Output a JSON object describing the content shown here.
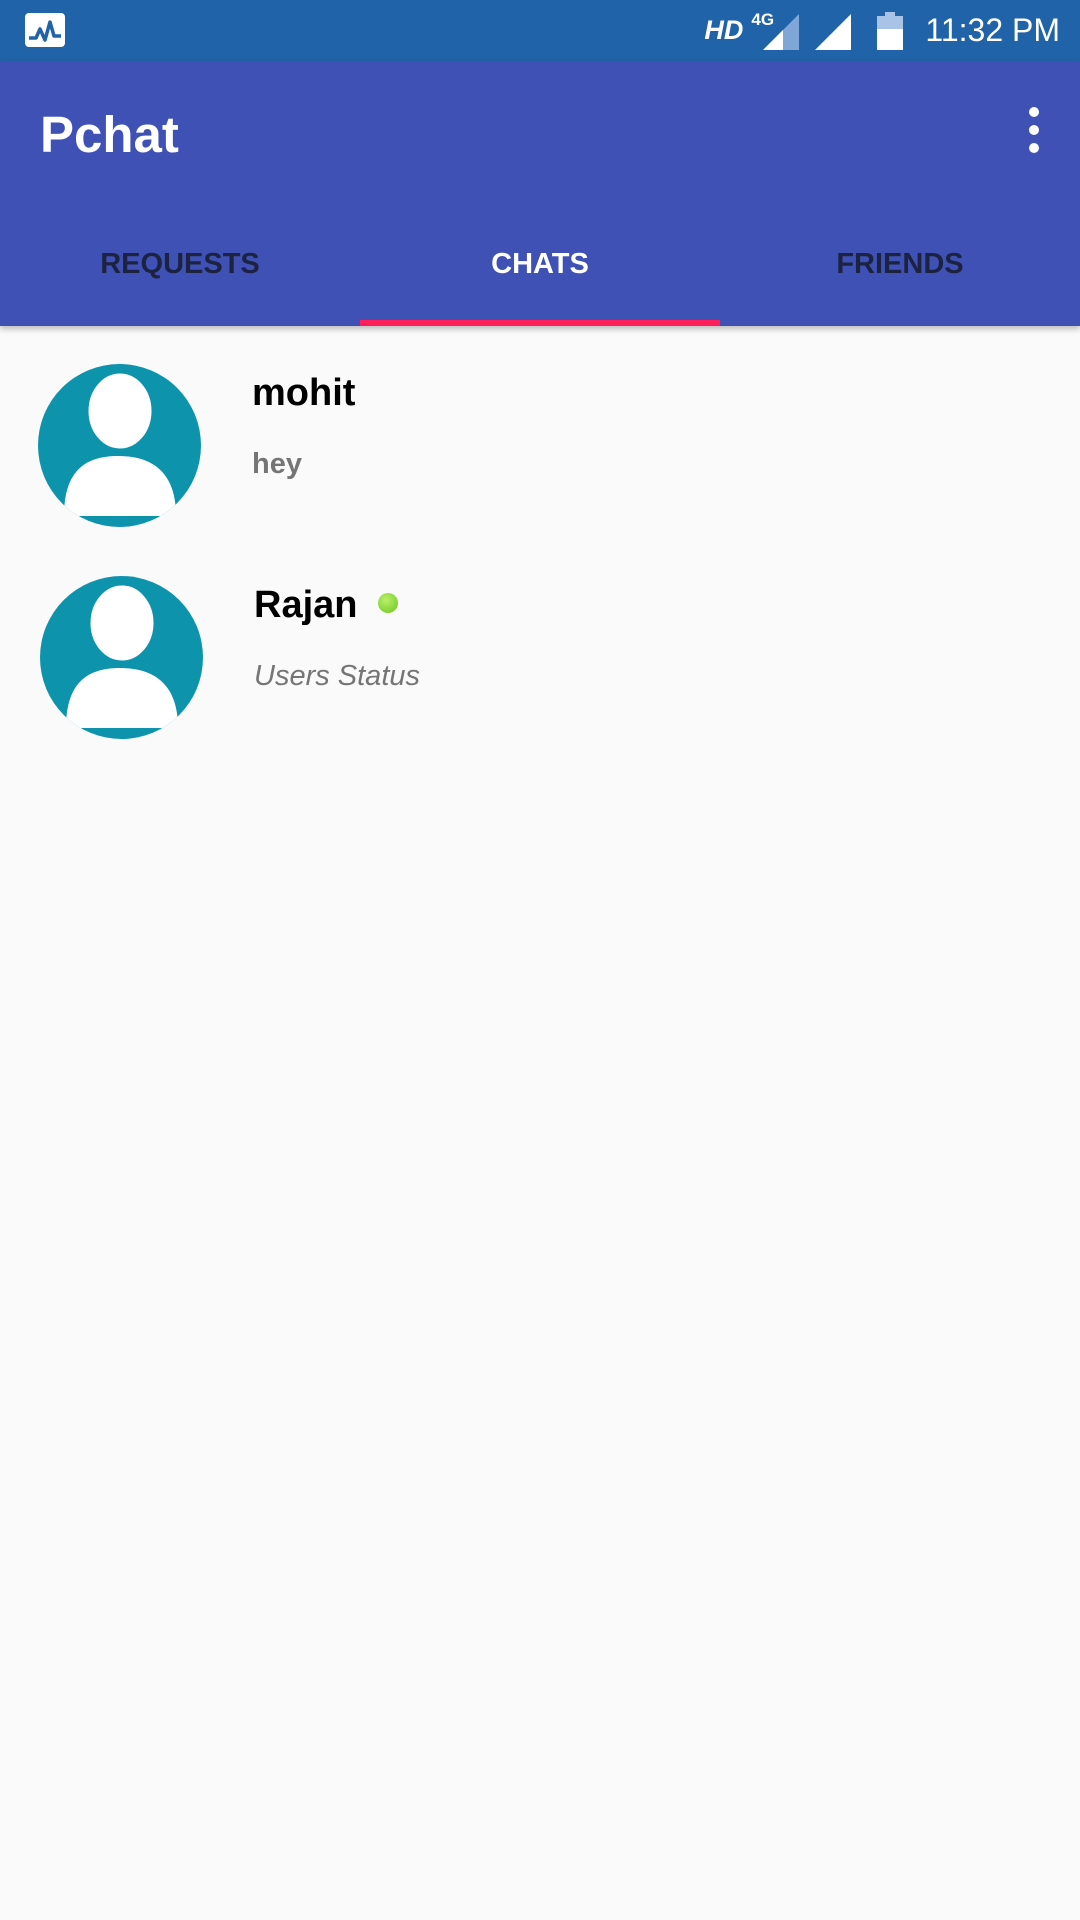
{
  "status_bar": {
    "network_label": "HD",
    "network_type": "4G",
    "time": "11:32 PM",
    "left_icon": "activity-monitor-icon"
  },
  "app_bar": {
    "title": "Pchat",
    "menu_icon": "more-vert-icon"
  },
  "tabs": [
    {
      "label": "REQUESTS",
      "active": false
    },
    {
      "label": "CHATS",
      "active": true
    },
    {
      "label": "FRIENDS",
      "active": false
    }
  ],
  "chats": [
    {
      "name": "mohit",
      "message": "hey",
      "online": false
    },
    {
      "name": "Rajan",
      "message": "Users Status",
      "online": true
    }
  ],
  "colors": {
    "status_bar": "#2163a8",
    "app_bar": "#3f51b5",
    "tab_indicator": "#ff1f5a",
    "avatar_bg": "#0e93ad",
    "online": "#7cd42a"
  }
}
